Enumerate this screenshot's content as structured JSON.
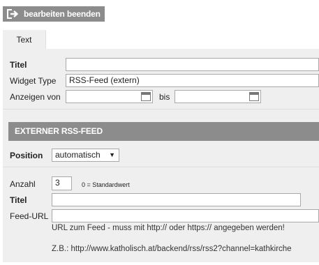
{
  "toolbar": {
    "exit_label": "bearbeiten beenden"
  },
  "tabs": [
    {
      "label": "Text"
    }
  ],
  "form": {
    "title_label": "Titel",
    "title_value": "",
    "widget_type_label": "Widget Type",
    "widget_type_value": "RSS-Feed (extern)",
    "show_from_label": "Anzeigen von",
    "show_from_value": "",
    "until_label": "bis",
    "until_value": ""
  },
  "rss": {
    "section_title": "EXTERNER RSS-FEED",
    "position_label": "Position",
    "position_value": "automatisch",
    "count_label": "Anzahl",
    "count_value": "3",
    "count_hint": "0 = Standardwert",
    "title_label": "Titel",
    "title_value": "",
    "feed_url_label": "Feed-URL",
    "feed_url_value": "",
    "feed_url_help": "URL zum Feed - muss mit http:// oder https:// angegeben werden!",
    "feed_url_example": "Z.B.: http://www.katholisch.at/backend/rss/rss2?channel=kathkirche"
  }
}
